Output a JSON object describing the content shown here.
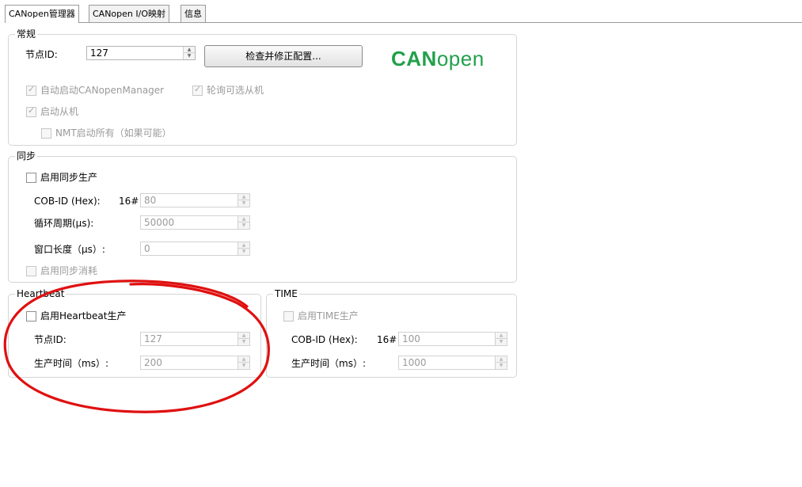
{
  "tabs": [
    {
      "label": "CANopen管理器",
      "active": true
    },
    {
      "label": "CANopen I/O映射",
      "active": false
    },
    {
      "label": "信息",
      "active": false
    }
  ],
  "general": {
    "title": "常规",
    "node_id_label": "节点ID:",
    "node_id_value": "127",
    "check_fix_button": "检查并修正配置...",
    "logo_bold": "CAN",
    "logo_light": "open",
    "auto_start_label": "自动启动CANopenManager",
    "poll_optional_label": "轮询可选从机",
    "start_slaves_label": "启动从机",
    "nmt_start_all_label": "NMT启动所有（如果可能）"
  },
  "sync": {
    "title": "同步",
    "enable_producing_label": "启用同步生产",
    "cob_id_label": "COB-ID (Hex):",
    "cob_id_prefix": "16#",
    "cob_id_value": "80",
    "cycle_period_label": "循环周期(µs):",
    "cycle_period_value": "50000",
    "window_length_label": "窗口长度（µs）:",
    "window_length_value": "0",
    "enable_consuming_label": "启用同步消耗"
  },
  "heartbeat": {
    "title": "Heartbeat",
    "enable_producing_label": "启用Heartbeat生产",
    "node_id_label": "节点ID:",
    "node_id_value": "127",
    "producer_time_label": "生产时间（ms）:",
    "producer_time_value": "200"
  },
  "time": {
    "title": "TIME",
    "enable_producing_label": "启用TIME生产",
    "cob_id_label": "COB-ID (Hex):",
    "cob_id_prefix": "16#",
    "cob_id_value": "100",
    "producer_time_label": "生产时间（ms）:",
    "producer_time_value": "1000"
  },
  "colors": {
    "logo_green": "#22a04b",
    "annotation_red": "#e01010"
  }
}
